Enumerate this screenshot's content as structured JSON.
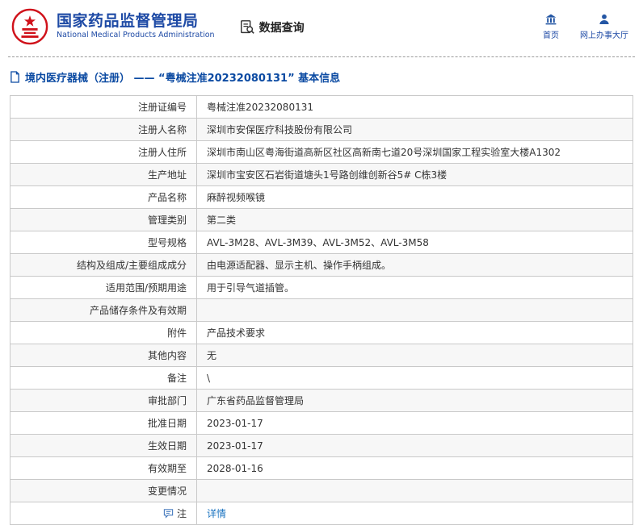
{
  "header": {
    "agency_name": "国家药品监督管理局",
    "agency_name_en": "National Medical Products Administration",
    "section_label": "数据查询",
    "nav": [
      {
        "label": "首页",
        "icon": "home-icon"
      },
      {
        "label": "网上办事大厅",
        "icon": "user-icon"
      }
    ]
  },
  "page": {
    "title": "境内医疗器械（注册） ——  “粤械注准20232080131”  基本信息"
  },
  "colors": {
    "brand_blue": "#1e4aa5",
    "title_blue": "#0b4aa2",
    "link_blue": "#1a73c0",
    "emblem_red": "#d0121b"
  },
  "table": {
    "rows": [
      {
        "label": "注册证编号",
        "value": "粤械注准20232080131"
      },
      {
        "label": "注册人名称",
        "value": "深圳市安保医疗科技股份有限公司"
      },
      {
        "label": "注册人住所",
        "value": "深圳市南山区粤海街道高新区社区高新南七道20号深圳国家工程实验室大楼A1302"
      },
      {
        "label": "生产地址",
        "value": "深圳市宝安区石岩街道塘头1号路创维创新谷5# C栋3楼"
      },
      {
        "label": "产品名称",
        "value": "麻醉视频喉镜"
      },
      {
        "label": "管理类别",
        "value": "第二类"
      },
      {
        "label": "型号规格",
        "value": "AVL-3M28、AVL-3M39、AVL-3M52、AVL-3M58"
      },
      {
        "label": "结构及组成/主要组成成分",
        "value": "由电源适配器、显示主机、操作手柄组成。"
      },
      {
        "label": "适用范围/预期用途",
        "value": "用于引导气道插管。"
      },
      {
        "label": "产品储存条件及有效期",
        "value": ""
      },
      {
        "label": "附件",
        "value": "产品技术要求"
      },
      {
        "label": "其他内容",
        "value": "无"
      },
      {
        "label": "备注",
        "value": "\\"
      },
      {
        "label": "审批部门",
        "value": "广东省药品监督管理局"
      },
      {
        "label": "批准日期",
        "value": "2023-01-17"
      },
      {
        "label": "生效日期",
        "value": "2023-01-17"
      },
      {
        "label": "有效期至",
        "value": "2028-01-16"
      },
      {
        "label": "变更情况",
        "value": ""
      },
      {
        "label": "注",
        "value": "详情",
        "icon": "note-icon",
        "value_is_link": true
      }
    ]
  }
}
